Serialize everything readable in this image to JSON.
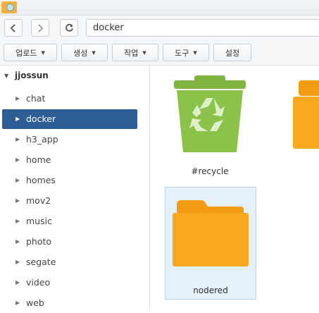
{
  "window": {
    "app_icon": "file-station-icon"
  },
  "nav": {
    "back_icon": "chevron-left-icon",
    "forward_icon": "chevron-right-icon",
    "refresh_icon": "refresh-icon",
    "path": "docker"
  },
  "toolbar": {
    "upload_label": "업로드",
    "create_label": "생성",
    "action_label": "작업",
    "tools_label": "도구",
    "settings_label": "설정"
  },
  "sidebar": {
    "root_label": "jjossun",
    "items": [
      {
        "label": "chat",
        "selected": false
      },
      {
        "label": "docker",
        "selected": true
      },
      {
        "label": "h3_app",
        "selected": false
      },
      {
        "label": "home",
        "selected": false
      },
      {
        "label": "homes",
        "selected": false
      },
      {
        "label": "mov2",
        "selected": false
      },
      {
        "label": "music",
        "selected": false
      },
      {
        "label": "photo",
        "selected": false
      },
      {
        "label": "segate",
        "selected": false
      },
      {
        "label": "video",
        "selected": false
      },
      {
        "label": "web",
        "selected": false
      }
    ]
  },
  "files": [
    {
      "name": "#recycle",
      "icon": "recycle-bin-icon",
      "selected": false
    },
    {
      "name": "",
      "icon": "folder-icon",
      "selected": false
    },
    {
      "name": "nodered",
      "icon": "folder-icon",
      "selected": true
    }
  ],
  "colors": {
    "selection": "#2d5e93",
    "folder": "#f7a81c",
    "recycle": "#8bc34a"
  }
}
